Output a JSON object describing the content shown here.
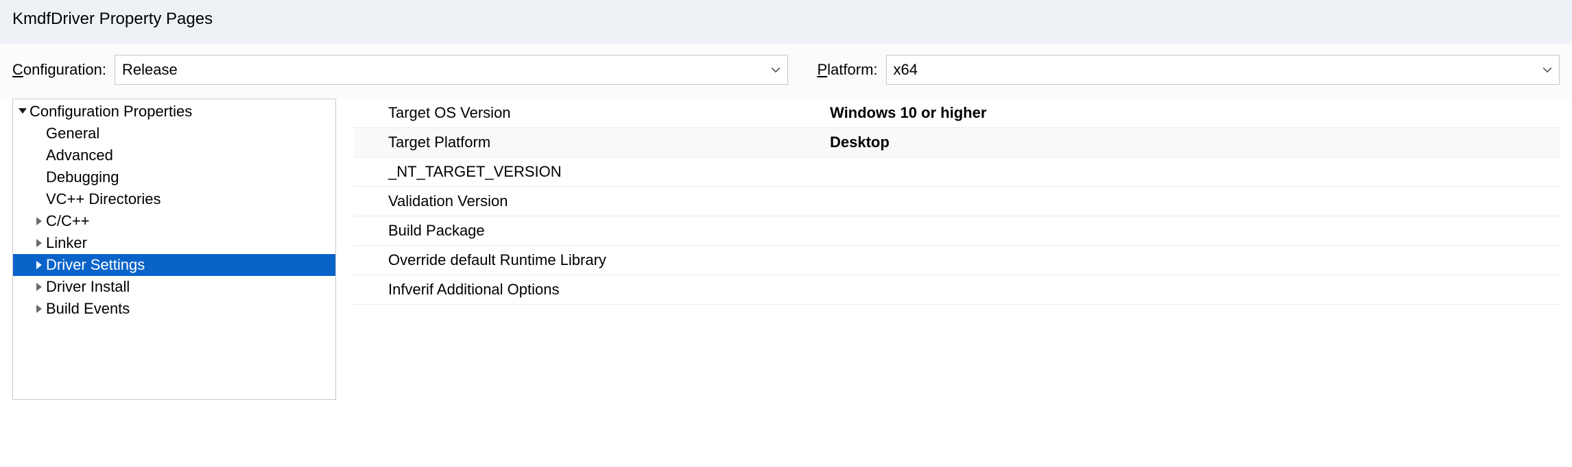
{
  "title": "KmdfDriver Property Pages",
  "config": {
    "label_pre": "C",
    "label_post": "onfiguration:",
    "value": "Release"
  },
  "platform": {
    "label_pre": "P",
    "label_post": "latform:",
    "value": "x64"
  },
  "tree": {
    "root": "Configuration Properties",
    "items": [
      {
        "label": "General"
      },
      {
        "label": "Advanced"
      },
      {
        "label": "Debugging"
      },
      {
        "label": "VC++ Directories"
      },
      {
        "label": "C/C++",
        "expandable": true
      },
      {
        "label": "Linker",
        "expandable": true
      },
      {
        "label": "Driver Settings",
        "expandable": true,
        "selected": true
      },
      {
        "label": "Driver Install",
        "expandable": true
      },
      {
        "label": "Build Events",
        "expandable": true
      }
    ]
  },
  "grid": {
    "rows": [
      {
        "label": "Target OS Version",
        "value": "Windows 10 or higher",
        "bold": true,
        "alt": false
      },
      {
        "label": "Target Platform",
        "value": "Desktop",
        "bold": true,
        "alt": true
      },
      {
        "label": "_NT_TARGET_VERSION",
        "value": "",
        "alt": false
      },
      {
        "label": "Validation Version",
        "value": "",
        "alt": false
      },
      {
        "label": "Build Package",
        "value": "",
        "alt": false
      },
      {
        "label": "Override default Runtime Library",
        "value": "",
        "alt": false
      },
      {
        "label": "Infverif Additional Options",
        "value": "",
        "alt": false
      }
    ]
  }
}
